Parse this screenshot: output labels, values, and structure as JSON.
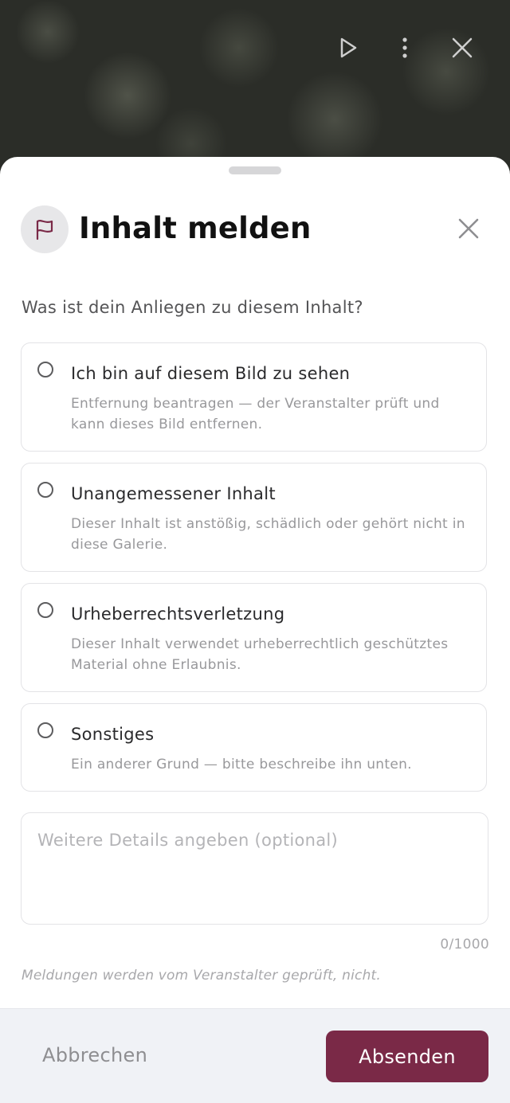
{
  "dialog": {
    "title": "Inhalt melden",
    "question": "Was ist dein Anliegen zu diesem Inhalt?",
    "options": [
      {
        "title": "Ich bin auf diesem Bild zu sehen",
        "description": "Entfernung beantragen — der Veranstalter prüft und kann dieses Bild entfernen.",
        "selected": false
      },
      {
        "title": "Unangemessener Inhalt",
        "description": "Dieser Inhalt ist anstößig, schädlich oder gehört nicht in diese Galerie.",
        "selected": false
      },
      {
        "title": "Urheberrechtsverletzung",
        "description": "Dieser Inhalt verwendet urheberrechtlich geschütztes Material ohne Erlaubnis.",
        "selected": false
      },
      {
        "title": "Sonstiges",
        "description": "Ein anderer Grund — bitte beschreibe ihn unten.",
        "selected": false
      }
    ],
    "details": {
      "placeholder": "Weitere Details angeben (optional)",
      "value": ""
    },
    "counter": "0/1000",
    "note": "Meldungen werden vom Veranstalter geprüft, nicht.",
    "cancel_label": "Abbrechen",
    "submit_label": "Absenden"
  },
  "viewer_toolbar": {
    "icons": [
      "play-icon",
      "more-vertical-icon",
      "close-icon"
    ]
  },
  "colors": {
    "accent": "#7a2947",
    "footer_bg": "#f0f2f6"
  }
}
